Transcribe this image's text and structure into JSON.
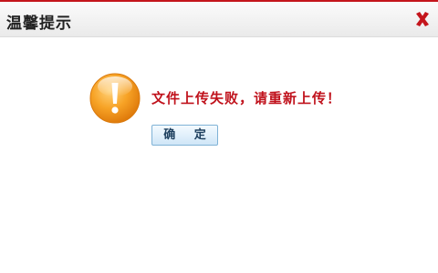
{
  "dialog": {
    "title": "温馨提示",
    "message": "文件上传失败，请重新上传！",
    "ok_label": "确 定",
    "close_icon": "close-icon",
    "warning_icon": "warning-icon"
  },
  "colors": {
    "accent": "#c4151c",
    "message": "#c0121c",
    "icon_orange": "#f39a1e",
    "button_border": "#7fb2d6"
  }
}
